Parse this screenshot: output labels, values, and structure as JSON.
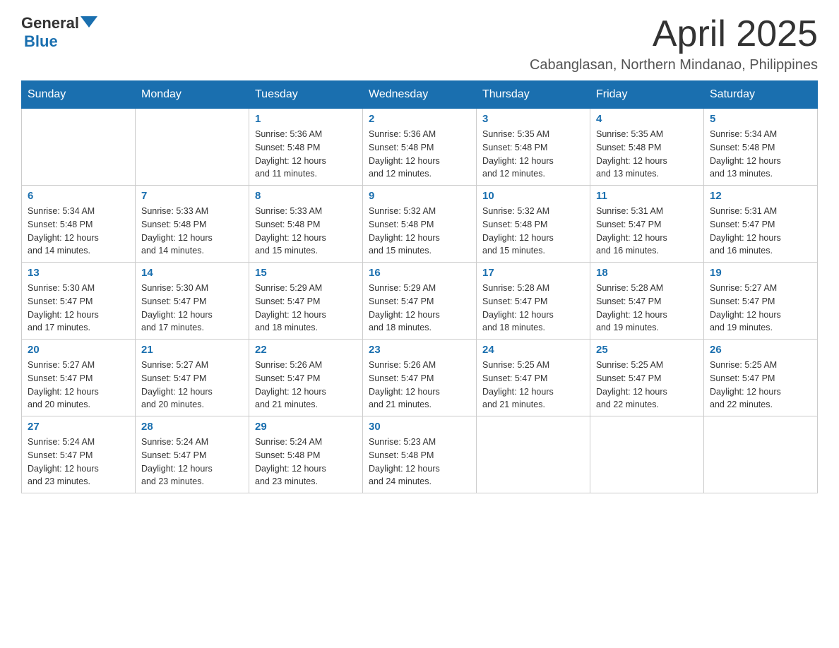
{
  "logo": {
    "general": "General",
    "blue": "Blue"
  },
  "title": "April 2025",
  "location": "Cabanglasan, Northern Mindanao, Philippines",
  "weekdays": [
    "Sunday",
    "Monday",
    "Tuesday",
    "Wednesday",
    "Thursday",
    "Friday",
    "Saturday"
  ],
  "weeks": [
    [
      {
        "day": "",
        "info": ""
      },
      {
        "day": "",
        "info": ""
      },
      {
        "day": "1",
        "info": "Sunrise: 5:36 AM\nSunset: 5:48 PM\nDaylight: 12 hours\nand 11 minutes."
      },
      {
        "day": "2",
        "info": "Sunrise: 5:36 AM\nSunset: 5:48 PM\nDaylight: 12 hours\nand 12 minutes."
      },
      {
        "day": "3",
        "info": "Sunrise: 5:35 AM\nSunset: 5:48 PM\nDaylight: 12 hours\nand 12 minutes."
      },
      {
        "day": "4",
        "info": "Sunrise: 5:35 AM\nSunset: 5:48 PM\nDaylight: 12 hours\nand 13 minutes."
      },
      {
        "day": "5",
        "info": "Sunrise: 5:34 AM\nSunset: 5:48 PM\nDaylight: 12 hours\nand 13 minutes."
      }
    ],
    [
      {
        "day": "6",
        "info": "Sunrise: 5:34 AM\nSunset: 5:48 PM\nDaylight: 12 hours\nand 14 minutes."
      },
      {
        "day": "7",
        "info": "Sunrise: 5:33 AM\nSunset: 5:48 PM\nDaylight: 12 hours\nand 14 minutes."
      },
      {
        "day": "8",
        "info": "Sunrise: 5:33 AM\nSunset: 5:48 PM\nDaylight: 12 hours\nand 15 minutes."
      },
      {
        "day": "9",
        "info": "Sunrise: 5:32 AM\nSunset: 5:48 PM\nDaylight: 12 hours\nand 15 minutes."
      },
      {
        "day": "10",
        "info": "Sunrise: 5:32 AM\nSunset: 5:48 PM\nDaylight: 12 hours\nand 15 minutes."
      },
      {
        "day": "11",
        "info": "Sunrise: 5:31 AM\nSunset: 5:47 PM\nDaylight: 12 hours\nand 16 minutes."
      },
      {
        "day": "12",
        "info": "Sunrise: 5:31 AM\nSunset: 5:47 PM\nDaylight: 12 hours\nand 16 minutes."
      }
    ],
    [
      {
        "day": "13",
        "info": "Sunrise: 5:30 AM\nSunset: 5:47 PM\nDaylight: 12 hours\nand 17 minutes."
      },
      {
        "day": "14",
        "info": "Sunrise: 5:30 AM\nSunset: 5:47 PM\nDaylight: 12 hours\nand 17 minutes."
      },
      {
        "day": "15",
        "info": "Sunrise: 5:29 AM\nSunset: 5:47 PM\nDaylight: 12 hours\nand 18 minutes."
      },
      {
        "day": "16",
        "info": "Sunrise: 5:29 AM\nSunset: 5:47 PM\nDaylight: 12 hours\nand 18 minutes."
      },
      {
        "day": "17",
        "info": "Sunrise: 5:28 AM\nSunset: 5:47 PM\nDaylight: 12 hours\nand 18 minutes."
      },
      {
        "day": "18",
        "info": "Sunrise: 5:28 AM\nSunset: 5:47 PM\nDaylight: 12 hours\nand 19 minutes."
      },
      {
        "day": "19",
        "info": "Sunrise: 5:27 AM\nSunset: 5:47 PM\nDaylight: 12 hours\nand 19 minutes."
      }
    ],
    [
      {
        "day": "20",
        "info": "Sunrise: 5:27 AM\nSunset: 5:47 PM\nDaylight: 12 hours\nand 20 minutes."
      },
      {
        "day": "21",
        "info": "Sunrise: 5:27 AM\nSunset: 5:47 PM\nDaylight: 12 hours\nand 20 minutes."
      },
      {
        "day": "22",
        "info": "Sunrise: 5:26 AM\nSunset: 5:47 PM\nDaylight: 12 hours\nand 21 minutes."
      },
      {
        "day": "23",
        "info": "Sunrise: 5:26 AM\nSunset: 5:47 PM\nDaylight: 12 hours\nand 21 minutes."
      },
      {
        "day": "24",
        "info": "Sunrise: 5:25 AM\nSunset: 5:47 PM\nDaylight: 12 hours\nand 21 minutes."
      },
      {
        "day": "25",
        "info": "Sunrise: 5:25 AM\nSunset: 5:47 PM\nDaylight: 12 hours\nand 22 minutes."
      },
      {
        "day": "26",
        "info": "Sunrise: 5:25 AM\nSunset: 5:47 PM\nDaylight: 12 hours\nand 22 minutes."
      }
    ],
    [
      {
        "day": "27",
        "info": "Sunrise: 5:24 AM\nSunset: 5:47 PM\nDaylight: 12 hours\nand 23 minutes."
      },
      {
        "day": "28",
        "info": "Sunrise: 5:24 AM\nSunset: 5:47 PM\nDaylight: 12 hours\nand 23 minutes."
      },
      {
        "day": "29",
        "info": "Sunrise: 5:24 AM\nSunset: 5:48 PM\nDaylight: 12 hours\nand 23 minutes."
      },
      {
        "day": "30",
        "info": "Sunrise: 5:23 AM\nSunset: 5:48 PM\nDaylight: 12 hours\nand 24 minutes."
      },
      {
        "day": "",
        "info": ""
      },
      {
        "day": "",
        "info": ""
      },
      {
        "day": "",
        "info": ""
      }
    ]
  ]
}
